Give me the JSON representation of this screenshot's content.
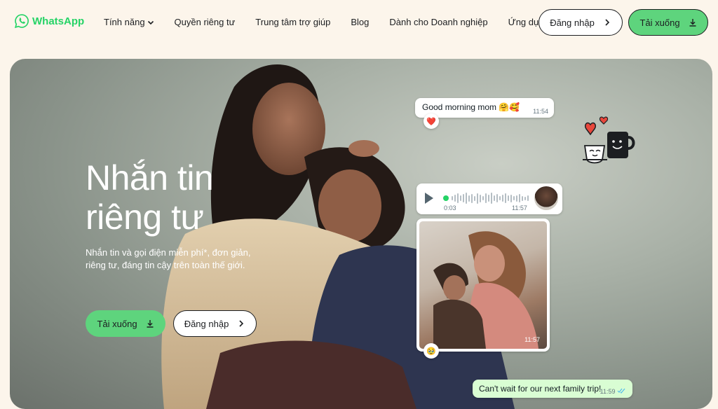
{
  "brand": {
    "name": "WhatsApp",
    "color": "#25d366"
  },
  "nav": {
    "items": [
      {
        "label": "Tính năng",
        "has_dropdown": true
      },
      {
        "label": "Quyền riêng tư"
      },
      {
        "label": "Trung tâm trợ giúp"
      },
      {
        "label": "Blog"
      },
      {
        "label": "Dành cho Doanh nghiệp"
      },
      {
        "label": "Ứng dụng"
      }
    ],
    "login_label": "Đăng nhập",
    "download_label": "Tải xuống"
  },
  "hero": {
    "title_line1": "Nhắn tin",
    "title_line2": "riêng tư",
    "subtitle": "Nhắn tin và gọi điện miễn phí*, đơn giản, riêng tư, đáng tin cậy trên toàn thế giới.",
    "download_label": "Tải xuống",
    "login_label": "Đăng nhập"
  },
  "chat": {
    "morning": {
      "text": "Good morning mom 🤗🥰",
      "time": "11:54",
      "reaction": "❤️"
    },
    "voice": {
      "elapsed": "0:03",
      "time": "11:57"
    },
    "photo": {
      "time": "11:57",
      "reaction": "🥹"
    },
    "trip": {
      "text": "Can't wait for our next family trip!",
      "time": "11:59",
      "status": "read"
    }
  },
  "colors": {
    "accent": "#25d366",
    "button_green": "#5ed47d",
    "background": "#fcf5eb",
    "outgoing_bubble": "#d9fdd3"
  }
}
